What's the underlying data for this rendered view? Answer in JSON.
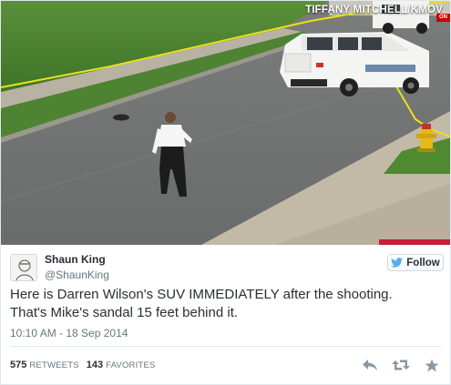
{
  "photo": {
    "credit": "TIFFANY MITCHELL/KMOV",
    "badge": "ON",
    "description_icon": "news-photo"
  },
  "author": {
    "display_name": "Shaun King",
    "handle": "@ShaunKing",
    "avatar_icon": "avatar-sketch"
  },
  "follow_button": {
    "label": "Follow",
    "icon": "twitter-bird-icon"
  },
  "tweet": {
    "line1": "Here is Darren Wilson's SUV IMMEDIATELY after the shooting.",
    "line2": "That's Mike's sandal 15 feet behind it."
  },
  "timestamp": "10:10 AM - 18 Sep 2014",
  "stats": {
    "retweets_count": "575",
    "retweets_label": "RETWEETS",
    "favorites_count": "143",
    "favorites_label": "FAVORITES"
  },
  "actions": {
    "reply_icon": "reply-icon",
    "retweet_icon": "retweet-icon",
    "favorite_icon": "star-icon"
  },
  "colors": {
    "accent": "#55acee",
    "text": "#292f33",
    "muted": "#66757f",
    "border": "#e1e8ed",
    "tape": "#e8e21a"
  }
}
